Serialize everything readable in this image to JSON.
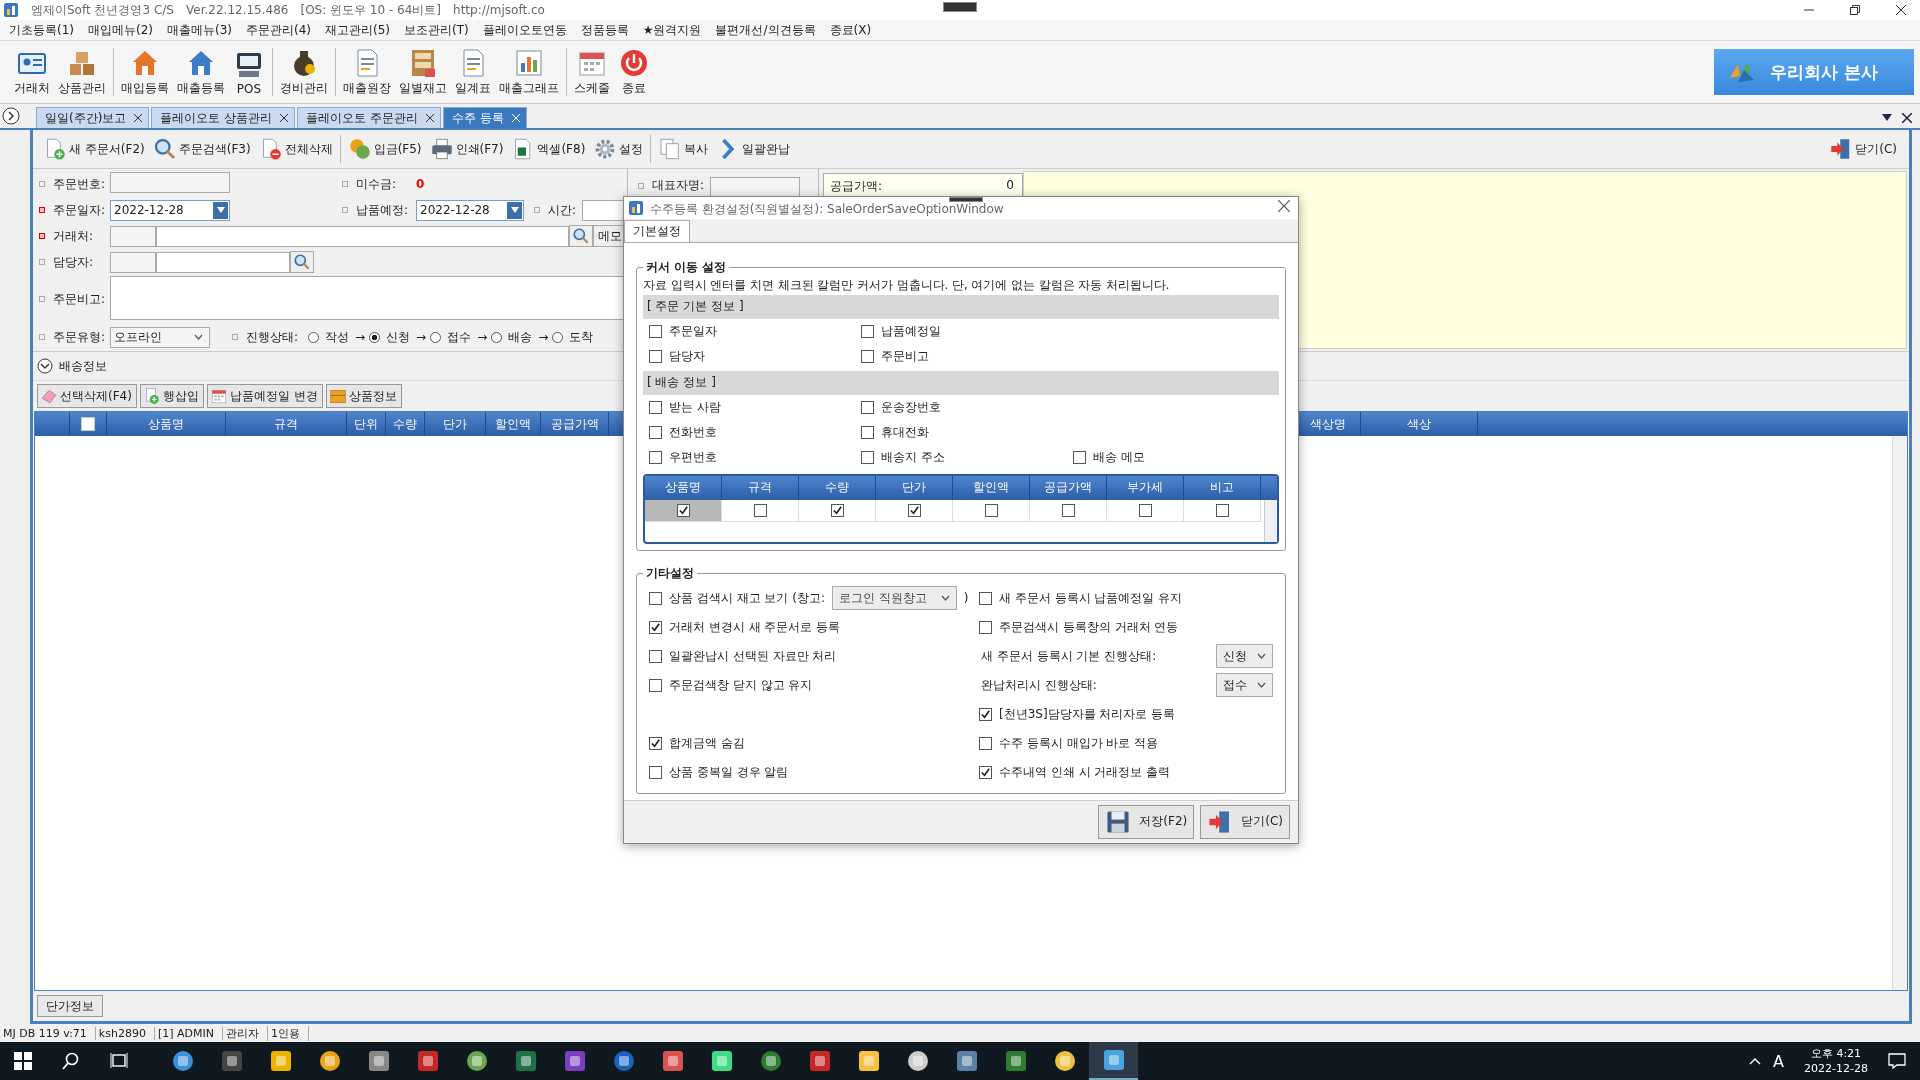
{
  "window": {
    "title_parts": [
      "엠제이Soft 천년경영3 C/S",
      "Ver.22.12.15.486",
      "[OS: 윈도우 10 - 64비트]",
      "http://mjsoft.co"
    ]
  },
  "menu": [
    "기초등록(1)",
    "매입메뉴(2)",
    "매출메뉴(3)",
    "주문관리(4)",
    "재고관리(5)",
    "보조관리(T)",
    "플레이오토연동",
    "정품등록",
    "★원격지원",
    "불편개선/의견등록",
    "종료(X)"
  ],
  "toolbar": [
    [
      "거래처",
      "상품관리"
    ],
    [
      "매입등록",
      "매출등록",
      "POS"
    ],
    [
      "경비관리"
    ],
    [
      "매출원장",
      "일별재고",
      "일계표",
      "매출그래프"
    ],
    [
      "스케줄",
      "종료"
    ]
  ],
  "company_button": "우리회사 본사",
  "tabs": [
    {
      "label": "일일(주간)보고",
      "selected": false
    },
    {
      "label": "플레이오토 상품관리",
      "selected": false
    },
    {
      "label": "플레이오토 주문관리",
      "selected": false
    },
    {
      "label": "수주 등록",
      "selected": true
    }
  ],
  "doc_toolbar": [
    [
      "새 주문서(F2)",
      "주문검색(F3)",
      "전체삭제"
    ],
    [
      "입금(F5)",
      "인쇄(F7)",
      "엑셀(F8)",
      "설정"
    ],
    [
      "복사",
      "일괄완납"
    ]
  ],
  "close_button": "닫기(C)",
  "form": {
    "order_no": {
      "label": "주문번호:",
      "required": false
    },
    "balance": {
      "label": "미수금:",
      "value": "0"
    },
    "order_date": {
      "label": "주문일자:",
      "required": true,
      "value": "2022-12-28"
    },
    "delivery_date": {
      "label": "납품예정:",
      "required": false,
      "value": "2022-12-28"
    },
    "time": {
      "label": "시간:",
      "required": false
    },
    "customer": {
      "label": "거래처:",
      "required": true,
      "memo_button": "메모"
    },
    "manager": {
      "label": "담당자:",
      "required": false
    },
    "note": {
      "label": "주문비고:",
      "required": false
    },
    "order_type": {
      "label": "주문유형:",
      "required": false,
      "value": "오프라인"
    },
    "status": {
      "label": "진행상태:",
      "required": false,
      "options": [
        {
          "label": "작성",
          "selected": false,
          "arrow": "→"
        },
        {
          "label": "신청",
          "selected": true,
          "arrow": "→"
        },
        {
          "label": "접수",
          "selected": false,
          "arrow": "→"
        },
        {
          "label": "배송",
          "selected": false,
          "arrow": "→"
        },
        {
          "label": "도착",
          "selected": false
        }
      ]
    }
  },
  "side_panel": {
    "owner_label": "대표자명:",
    "supply_label": "공급가액:",
    "supply_value": "0"
  },
  "delivery_toggle": {
    "label": "배송정보",
    "expanded": false
  },
  "grid_toolbar": [
    "선택삭제(F4)",
    "행삽입",
    "납품예정일 변경",
    "상품정보"
  ],
  "grid": {
    "all_checked": false,
    "columns": [
      "상품명",
      "규격",
      "단위",
      "수량",
      "단가",
      "할인액",
      "공급가액",
      "색상명",
      "색상"
    ]
  },
  "price_info_button": "단가정보",
  "status_bar": [
    "MJ DB 119 v:71",
    "ksh2890",
    "[1] ADMIN",
    "관리자",
    "1인용"
  ],
  "dialog": {
    "title": "수주등록 환경설정(직원별설정): SaleOrderSaveOptionWindow",
    "tabs": [
      {
        "label": "기본설정",
        "selected": true
      }
    ],
    "cursor_group": {
      "title": "커서 이동 설정",
      "description": "자료 입력시 엔터를 치면 체크된 칼럼만 커서가 멈춥니다. 단, 여기에 없는 칼럼은 자동 처리됩니다.",
      "sections": [
        {
          "title": "[ 주문 기본 정보 ]",
          "rows": [
            [
              {
                "label": "주문일자",
                "checked": false
              },
              {
                "label": "납품예정일",
                "checked": false
              }
            ],
            [
              {
                "label": "담당자",
                "checked": false
              },
              {
                "label": "주문비고",
                "checked": false
              }
            ]
          ]
        },
        {
          "title": "[ 배송 정보 ]",
          "rows": [
            [
              {
                "label": "받는 사람",
                "checked": false
              },
              {
                "label": "운송장번호",
                "checked": false
              }
            ],
            [
              {
                "label": "전화번호",
                "checked": false
              },
              {
                "label": "휴대전화",
                "checked": false
              }
            ],
            [
              {
                "label": "우편번호",
                "checked": false
              },
              {
                "label": "배송지 주소",
                "checked": false
              },
              {
                "label": "배송 메모",
                "checked": false
              }
            ]
          ]
        }
      ],
      "columns": [
        {
          "label": "상품명",
          "checked": true,
          "selected": true
        },
        {
          "label": "규격",
          "checked": false,
          "selected": false
        },
        {
          "label": "수량",
          "checked": true,
          "selected": false
        },
        {
          "label": "단가",
          "checked": true,
          "selected": false
        },
        {
          "label": "할인액",
          "checked": false,
          "selected": false
        },
        {
          "label": "공급가액",
          "checked": false,
          "selected": false
        },
        {
          "label": "부가세",
          "checked": false,
          "selected": false
        },
        {
          "label": "비고",
          "checked": false,
          "selected": false
        }
      ]
    },
    "other_group": {
      "title": "기타설정",
      "rows": [
        {
          "left": {
            "kind": "checkbox_select",
            "label": "상품 검색시 재고 보기 (창고:",
            "checked": false,
            "value": "로그인 직원창고",
            "suffix": ")"
          },
          "right": {
            "kind": "checkbox",
            "label": "새 주문서 등록시 납품예정일 유지",
            "checked": false
          }
        },
        {
          "left": {
            "kind": "checkbox",
            "label": "거래처 변경시 새 주문서로 등록",
            "checked": true
          },
          "right": {
            "kind": "checkbox",
            "label": "주문검색시 등록창의 거래처 연동",
            "checked": false
          }
        },
        {
          "left": {
            "kind": "checkbox",
            "label": "일괄완납시 선택된 자료만 처리",
            "checked": false
          },
          "right": {
            "kind": "select",
            "label": "새 주문서 등록시 기본 진행상태:",
            "value": "신청"
          }
        },
        {
          "left": {
            "kind": "checkbox",
            "label": "주문검색창 닫지 않고 유지",
            "checked": false
          },
          "right": {
            "kind": "select",
            "label": "완납처리시 진행상태:",
            "value": "접수"
          }
        },
        {
          "right": {
            "kind": "checkbox",
            "label": "[천년3S]담당자를 처리자로 등록",
            "checked": true
          }
        },
        {
          "left": {
            "kind": "checkbox",
            "label": "합계금액 숨김",
            "checked": true
          },
          "right": {
            "kind": "checkbox",
            "label": "수주 등록시 매입가 바로 적용",
            "checked": false
          }
        },
        {
          "left": {
            "kind": "checkbox",
            "label": "상품 중복일 경우 알림",
            "checked": false
          },
          "right": {
            "kind": "checkbox",
            "label": "수주내역 인쇄 시 거래정보 출력",
            "checked": true
          }
        }
      ]
    },
    "buttons": [
      "저장(F2)",
      "닫기(C)"
    ]
  },
  "taskbar": {
    "ime": "A",
    "time": "오후 4:21",
    "date": "2022-12-28"
  }
}
